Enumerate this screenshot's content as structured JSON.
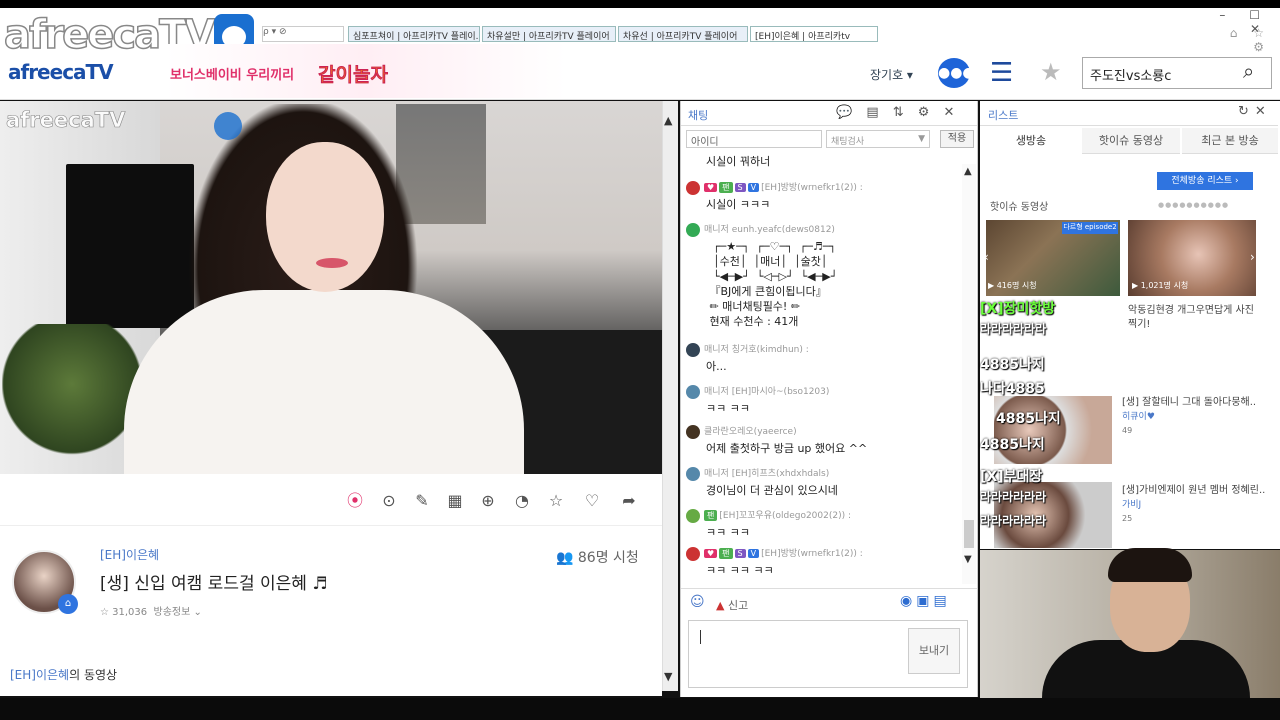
{
  "browser": {
    "watermark": "afreecaTV",
    "address": "ρ ▾ ⊘",
    "tabs": [
      {
        "label": "심포프쳐이 | 아프리카TV 플레이..."
      },
      {
        "label": "차유설만 | 아프리카TV 플레이어"
      },
      {
        "label": "차유선 | 아프리카TV 플레이어"
      },
      {
        "label": "[EH]이은혜 | 아프리카tv"
      }
    ],
    "win_controls": "– ☐ ✕",
    "icons": "⌂ ☆ ⚙"
  },
  "header": {
    "logo": "afreecaTV",
    "banner_left": "보너스베이비 우리끼리",
    "banner_right": "같이놀자",
    "user": "장기호 ▾",
    "search_value": "주도진vs소룡c"
  },
  "video": {
    "watermark": "afreecaTV"
  },
  "tools": {
    "icons": [
      "record-icon",
      "pin-icon",
      "edit-icon",
      "grid-icon",
      "gift-icon",
      "clock-icon",
      "star-icon",
      "thumbs-up-icon",
      "share-icon"
    ]
  },
  "broadcast": {
    "bj_name": "[EH]이은혜",
    "title": "[생] 신입 여캠 로드걸 이은혜 ♬",
    "favorites": "☆ 31,036",
    "info_link": "방송정보 ⌄",
    "viewers": "86명 시청",
    "vod_bj": "[EH]이은혜",
    "vod_suffix": "의 동영상"
  },
  "chat": {
    "title": "채팅",
    "icons": "💬 ▤ ⇅ ⚙ ✕",
    "filter_placeholder": "아이디",
    "select_label": "채팅검사",
    "apply": "적용",
    "messages": [
      {
        "head": "",
        "body": "시실이 꿔하너"
      },
      {
        "head": "[EH]방방(wrnefkr1(2)) :",
        "body": "시실이 ㅋㅋㅋ"
      },
      {
        "head": "매니저 eunh.yeafc(dews0812)",
        "body": "  ┌─★─┐  ┌─♡─┐  ┌─♬─┐\n  │수천│  │매너│  │술찻│\n  └◀─▶┘  └◁─▷┘  └◀─▶┘\n 『BJ에게 큰힘이됩니다』\n ✏ 매너채팅필수! ✏\n 현재 수천수 : 41개"
      },
      {
        "head": "매니저 칭거호(kimdhun) :",
        "body": "아..."
      },
      {
        "head": "매니저 [EH]마시아~(bso1203)",
        "body": "ㅋㅋ ㅋㅋ"
      },
      {
        "head": "클라란오레오(yaeerce)",
        "body": "어제 출첫하구 방금 up 했어요 ^^"
      },
      {
        "head": "매니저 [EH]히프츠(xhdxhdals)",
        "body": "경이님이 더 관심이 있으시네"
      },
      {
        "head": "[EH]꼬꼬우유(oldego2002(2)) :",
        "body": "ㅋㅋ ㅋㅋ"
      },
      {
        "head": "[EH]방방(wrnefkr1(2)) :",
        "body": "ㅋㅋ ㅋㅋ ㅋㅋ"
      }
    ],
    "report": "신고",
    "send": "보내기"
  },
  "list": {
    "title": "리스트",
    "tabs": [
      "생방송",
      "핫이슈 동영상",
      "최근 본 방송"
    ],
    "all_live": "전체방송 리스트 ›",
    "hot_label": "핫이슈 동영상",
    "hot": [
      {
        "badge": "다르형 episode2",
        "meta": "▶ 416명 시청"
      },
      {
        "meta": "▶ 1,021명 시청",
        "caption": "악동김현경 개그우면답게 사진찍기!"
      }
    ],
    "overlay1": "[X]장미핫방",
    "overlay2": "라라라라라라",
    "overlay3": "4885나지",
    "overlay4": "나다4885",
    "overlay5": "4885나지",
    "overlay6": "4885나지",
    "overlay7": "[X]부대장",
    "overlay8": "라라라라라라",
    "overlay9": "라라라라라라",
    "items": [
      {
        "title": "[생] 잘할테니 그대 돌아다뭉해..",
        "bj": "히큐이♥",
        "viewers": "49"
      },
      {
        "title": "[생]가비엔제이 원년 멤버 정혜린..",
        "bj": "가비J",
        "viewers": "25"
      }
    ]
  }
}
